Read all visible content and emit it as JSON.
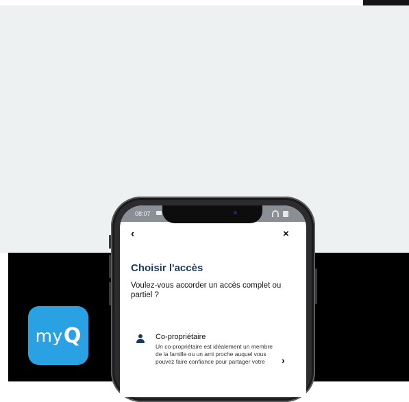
{
  "app_icon": {
    "logo_text": "my",
    "logo_q": "Q"
  },
  "phone": {
    "status_bar": {
      "time": "08:07"
    },
    "nav": {
      "back": "‹",
      "close": "×"
    },
    "title": "Choisir l'accès",
    "subtitle": "Voulez-vous accorder un accès complet ou partiel ?",
    "options": [
      {
        "label": "Co-propriétaire",
        "description": "Un co-propriétaire est idéalement un membre de la famille ou un ami proche auquel vous pouvez faire confiance pour partager votre",
        "chevron": "›"
      }
    ]
  },
  "colors": {
    "accent": "#2aa1e2",
    "title": "#1c3a5e",
    "background": "#eef1f2"
  }
}
